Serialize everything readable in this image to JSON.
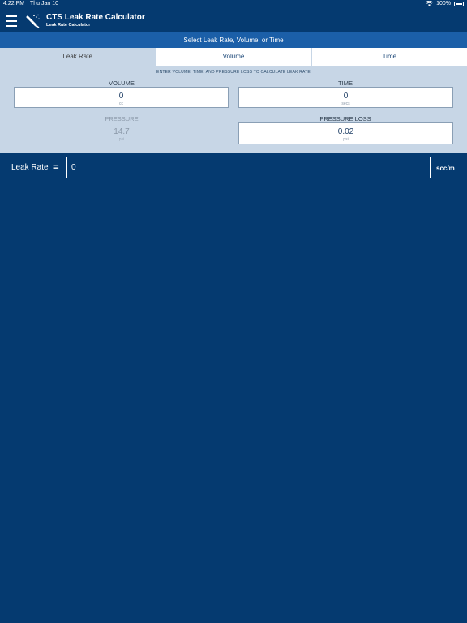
{
  "status_bar": {
    "time": "4:22 PM",
    "date": "Thu Jan 10",
    "battery": "100%",
    "icons": [
      "wifi-icon",
      "battery-icon"
    ]
  },
  "header": {
    "title": "CTS Leak Rate Calculator",
    "subtitle": "Leak Rate Calculator",
    "icons": [
      "menu-icon",
      "leak-detector-logo-icon"
    ]
  },
  "select_bar": {
    "label": "Select Leak Rate, Volume, or Time"
  },
  "tabs": [
    {
      "label": "Leak Rate",
      "active": true
    },
    {
      "label": "Volume",
      "active": false
    },
    {
      "label": "Time",
      "active": false
    }
  ],
  "instructions": "ENTER VOLUME, TIME, AND PRESSURE LOSS TO CALCULATE LEAK RATE",
  "fields": {
    "volume": {
      "label": "VOLUME",
      "value": "0",
      "unit": "cc"
    },
    "time": {
      "label": "TIME",
      "value": "0",
      "unit": "secs"
    },
    "pressure": {
      "label": "PRESSURE",
      "value": "14.7",
      "unit": "psi"
    },
    "pressure_loss": {
      "label": "PRESSURE LOSS",
      "value": "0.02",
      "unit": "psi"
    }
  },
  "result": {
    "label": "Leak Rate",
    "equals": "=",
    "value": "0",
    "unit": "scc/m"
  },
  "colors": {
    "background": "#053a70",
    "select_bar": "#1b5fa8",
    "panel": "#c7d6e6"
  }
}
